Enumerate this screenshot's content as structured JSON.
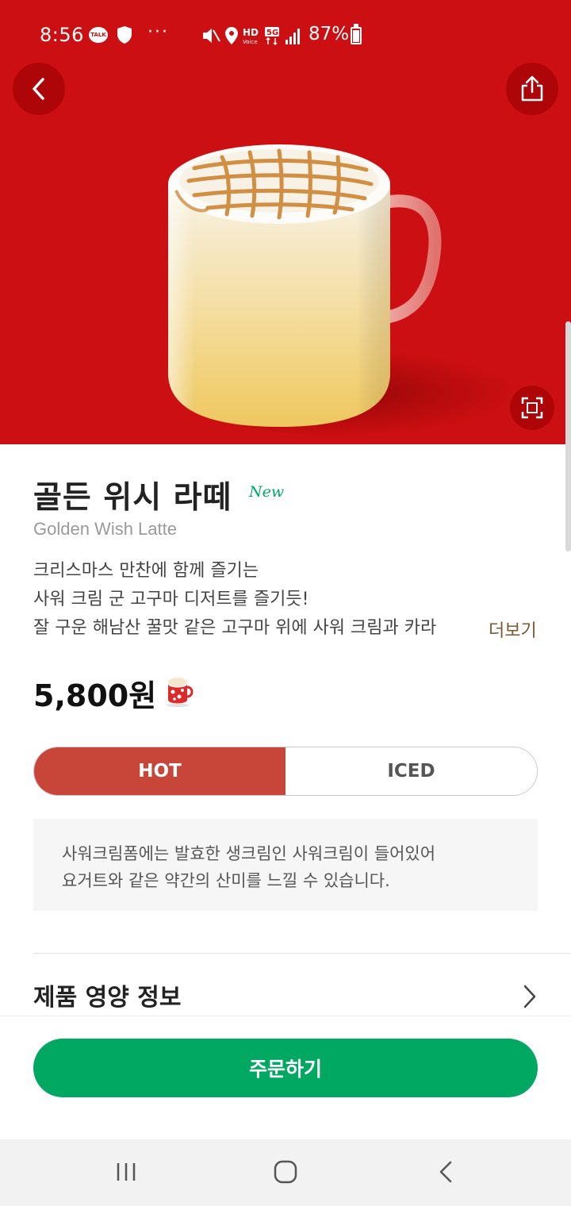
{
  "status_bar": {
    "time": "8:56",
    "talk_label": "TALK",
    "overflow": "···",
    "battery_percent": "87%",
    "icons": [
      "kakaotalk-icon",
      "shield-icon",
      "mute-icon",
      "location-icon",
      "hd-voice-icon",
      "5g-icon",
      "signal-icon",
      "battery-icon"
    ]
  },
  "hero": {
    "background_color": "#cc0f12",
    "image": "latte-mug-illustration",
    "buttons": [
      "back-icon",
      "share-icon",
      "expand-icon"
    ]
  },
  "product": {
    "name_ko": "골든 위시 라떼",
    "badge": "New",
    "name_en": "Golden Wish Latte",
    "description_lines": [
      "크리스마스 만찬에 함께 즐기는",
      "사워 크림 군 고구마 디저트를 즐기듯!",
      "잘 구운 해남산 꿀맛 같은 고구마 위에 사워 크림과 카라"
    ],
    "more_label": "더보기",
    "price": "5,800원"
  },
  "temperature": {
    "options": [
      "HOT",
      "ICED"
    ],
    "selected": "HOT",
    "selected_color": "#c8453a"
  },
  "notice": {
    "lines": [
      "사워크림폼에는 발효한 생크림인 사워크림이 들어있어",
      "요거트와 같은 약간의 산미를 느낄 수 있습니다."
    ]
  },
  "nutrition": {
    "label": "제품 영양 정보"
  },
  "order": {
    "button_label": "주문하기",
    "color": "#00a862"
  },
  "android_nav": [
    "recents-icon",
    "home-icon",
    "back-icon"
  ]
}
